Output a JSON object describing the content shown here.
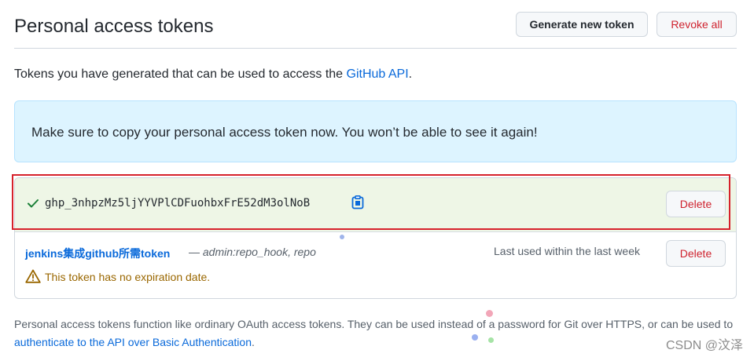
{
  "header": {
    "title": "Personal access tokens",
    "generate_label": "Generate new token",
    "revoke_label": "Revoke all"
  },
  "intro": {
    "text_before": "Tokens you have generated that can be used to access the ",
    "link_text": "GitHub API",
    "text_after": "."
  },
  "flash": {
    "message": "Make sure to copy your personal access token now. You won’t be able to see it again!"
  },
  "new_token": {
    "value": "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",
    "delete_label": "Delete"
  },
  "existing_token": {
    "name": "jenkins集成github所需token",
    "separator": " — ",
    "scopes": "admin:repo_hook, repo",
    "last_used": "Last used within the last week",
    "warning": "This token has no expiration date.",
    "delete_label": "Delete"
  },
  "footer": {
    "text_before": "Personal access tokens function like ordinary OAuth access tokens. They can be used instead of a password for Git over HTTPS, or can be used to ",
    "link_text": "authenticate to the API over Basic Authentication",
    "text_after": "."
  },
  "watermark": "CSDN @汶泽",
  "colors": {
    "accent": "#0969da",
    "danger": "#cf222e",
    "flash_bg": "#ddf4ff",
    "success_bg": "#eef6e6",
    "highlight": "#d6212b",
    "warning": "#9a6700"
  },
  "icons": [
    "check-icon",
    "clipboard-icon",
    "alert-icon"
  ]
}
